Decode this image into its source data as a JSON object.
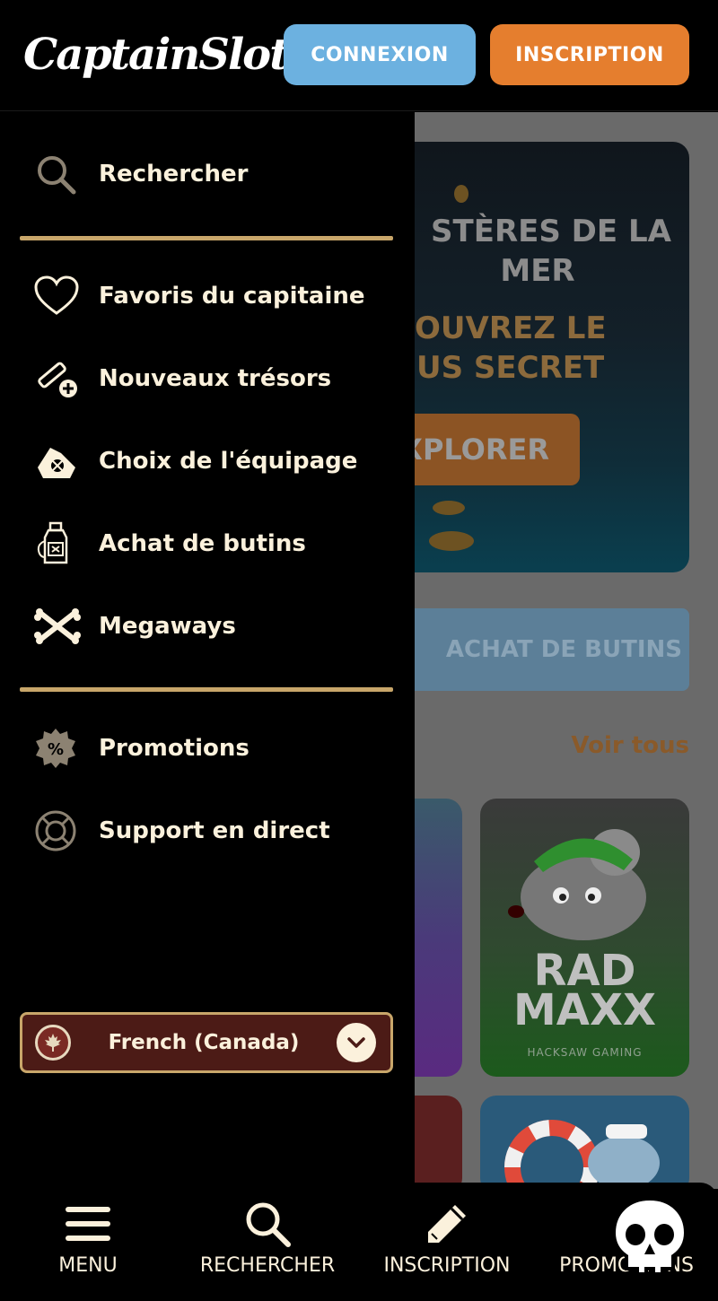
{
  "header": {
    "logo_text": "CaptainSlots",
    "login_label": "CONNEXION",
    "register_label": "INSCRIPTION",
    "colors": {
      "login": "#6cb1e0",
      "register": "#e57e2e"
    }
  },
  "drawer": {
    "search_label": "Rechercher",
    "categories": [
      {
        "label": "Favoris du capitaine",
        "icon": "heart-icon"
      },
      {
        "label": "Nouveaux trésors",
        "icon": "new-scroll-icon"
      },
      {
        "label": "Choix de l'équipage",
        "icon": "crew-choice-icon"
      },
      {
        "label": "Achat de butins",
        "icon": "potion-bottle-icon"
      },
      {
        "label": "Megaways",
        "icon": "crossed-bones-icon"
      }
    ],
    "extras": [
      {
        "label": "Promotions",
        "icon": "percent-badge-icon"
      },
      {
        "label": "Support en direct",
        "icon": "lifebuoy-icon"
      }
    ],
    "language": {
      "selected": "French (Canada)",
      "flag": "canada-flag-icon"
    },
    "divider_color": "#c8a66a"
  },
  "background": {
    "hero_title_1": "STÈRES DE LA",
    "hero_title_2": "MER",
    "hero_sub_1": "OUVREZ LE",
    "hero_sub_2": "US SECRET",
    "hero_button": "XPLORER",
    "category_bar": "ACHAT DE BUTINS",
    "see_all": "Voir tous",
    "tile_title_1": "RAD",
    "tile_title_2": "MAXX",
    "tile_maker": "HACKSAW GAMING"
  },
  "bottom_nav": [
    {
      "label": "MENU",
      "icon": "hamburger-icon"
    },
    {
      "label": "RECHERCHER",
      "icon": "search-icon"
    },
    {
      "label": "INSCRIPTION",
      "icon": "pencil-icon"
    },
    {
      "label": "PROMOTIONS",
      "icon": "promo-badge-icon"
    }
  ]
}
